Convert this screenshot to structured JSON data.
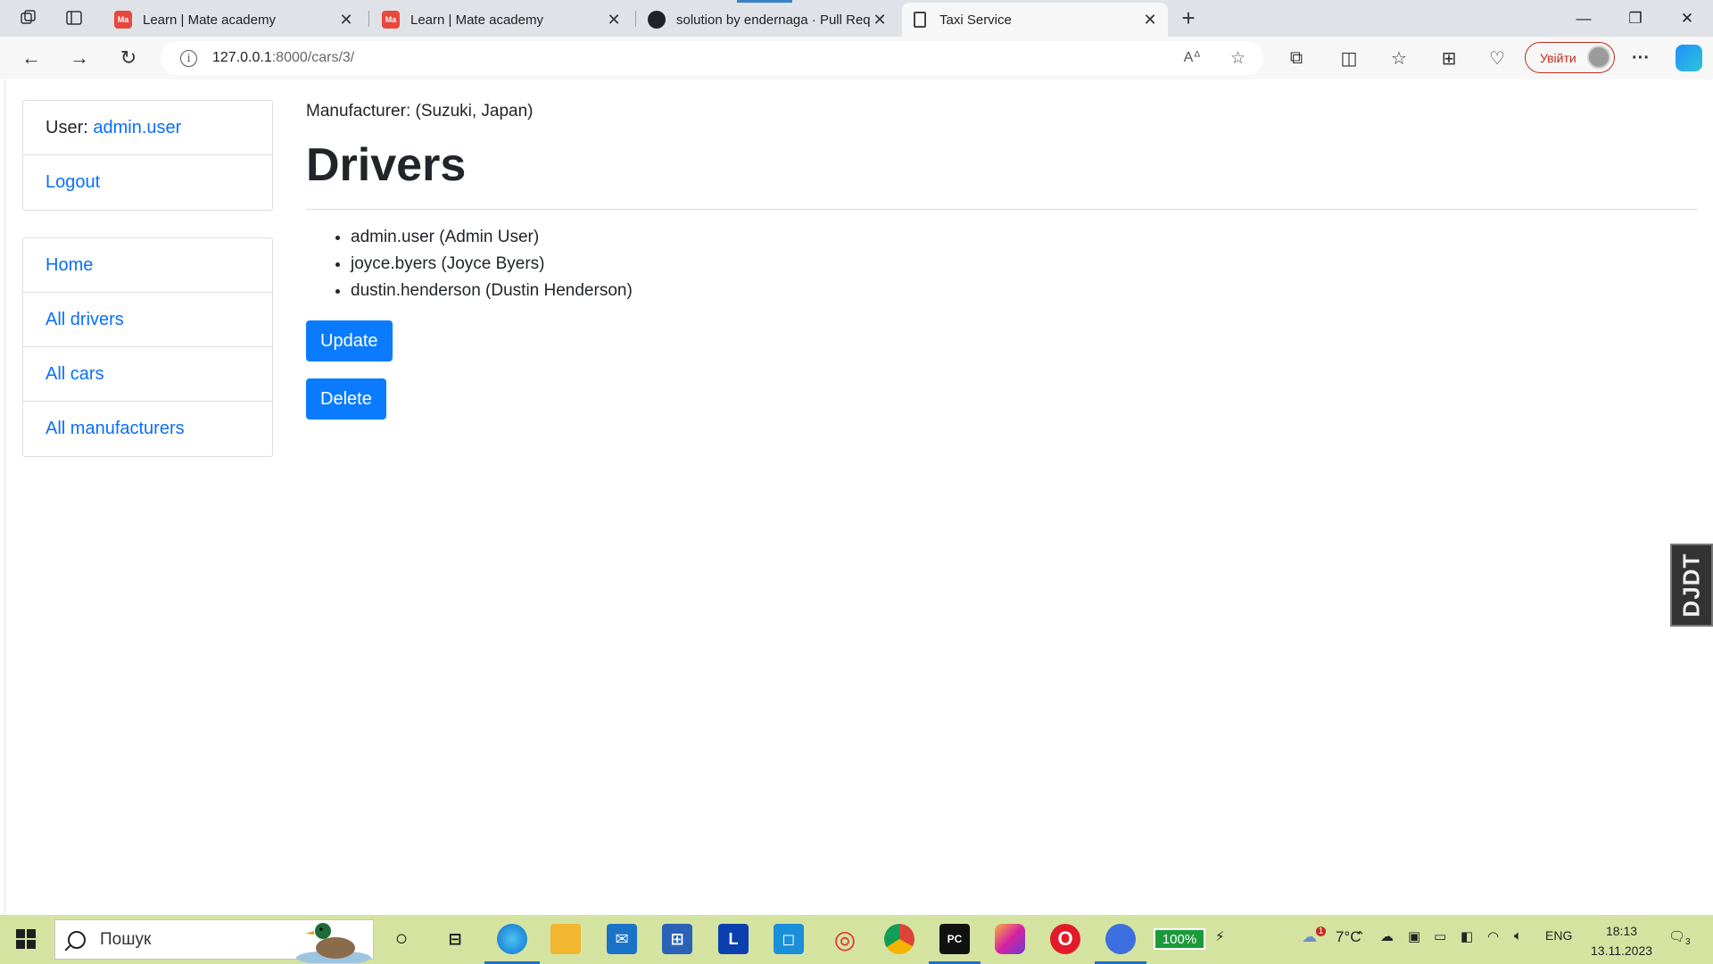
{
  "browser": {
    "tabs": [
      {
        "title": "Learn | Mate academy",
        "favicon": "mate-academy-icon"
      },
      {
        "title": "Learn | Mate academy",
        "favicon": "mate-academy-icon"
      },
      {
        "title": "solution by endernaga · Pull Req",
        "favicon": "github-icon"
      },
      {
        "title": "Taxi Service",
        "favicon": "document-icon"
      }
    ],
    "address": {
      "host": "127.0.0.1",
      "rest": ":8000/cars/3/"
    },
    "signin_label": "Увійти",
    "accent": "#c42b1c"
  },
  "page": {
    "user_label": "User:",
    "username": "admin.user",
    "logout": "Logout",
    "nav": [
      "Home",
      "All drivers",
      "All cars",
      "All manufacturers"
    ],
    "manufacturer_text": "Manufacturer: (Suzuki, Japan)",
    "title": "Drivers",
    "drivers": [
      "admin.user (Admin User)",
      "joyce.byers (Joyce Byers)",
      "dustin.henderson (Dustin Henderson)"
    ],
    "update_label": "Update",
    "delete_label": "Delete",
    "link_color": "#0a6efd",
    "button_color": "#0a7bff",
    "debug_toolbar_label": "DJDT"
  },
  "taskbar": {
    "search_placeholder": "Пошук",
    "battery": "100%",
    "temperature": "7°C",
    "weather_badge": "1",
    "language": "ENG",
    "time": "18:13",
    "date": "13.11.2023",
    "notifications": "3",
    "app_l_label": "L"
  }
}
